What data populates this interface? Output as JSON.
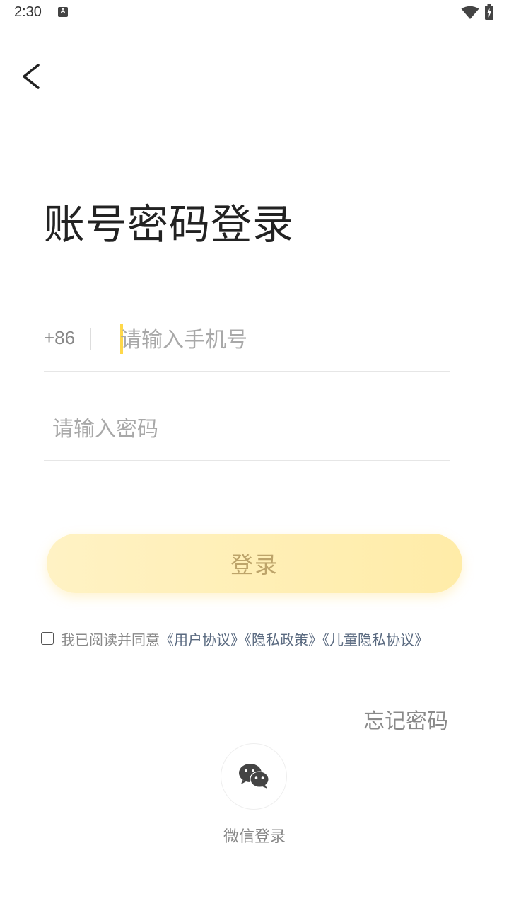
{
  "status_bar": {
    "time": "2:30",
    "notification_icon": "A"
  },
  "header": {
    "back_icon": "chevron-left-icon"
  },
  "title": "账号密码登录",
  "phone": {
    "country_code": "+86",
    "placeholder": "请输入手机号",
    "value": ""
  },
  "password": {
    "placeholder": "请输入密码",
    "value": ""
  },
  "login_button": {
    "label": "登录"
  },
  "agreement": {
    "checked": false,
    "prefix": "我已阅读并同意",
    "user_agreement": "《用户协议》",
    "privacy_policy": "《隐私政策》",
    "child_privacy": "《儿童隐私协议》"
  },
  "forgot_password": "忘记密码",
  "wechat_login": {
    "label": "微信登录",
    "icon": "wechat-icon"
  },
  "colors": {
    "accent": "#ffd84a",
    "button_bg": "#ffeca8",
    "button_text": "#bda46a",
    "link": "#5a6a80"
  }
}
